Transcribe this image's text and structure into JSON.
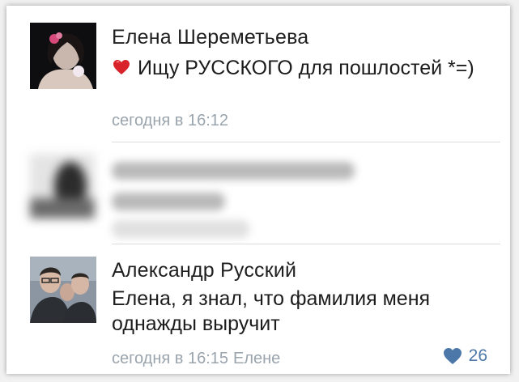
{
  "comments": [
    {
      "author": "Елена Шереметьева",
      "text": "Ищу РУССКОГО для пошлостей *=)",
      "time": "сегодня в 16:12",
      "emoji_icon": "red-heart-emoji-icon"
    },
    {
      "author": "",
      "text": "",
      "time": "",
      "blurred": true
    },
    {
      "author": "Александр Русский",
      "text": "Елена, я знал, что фамилия меня однажды выручит",
      "time": "сегодня в 16:15",
      "reply_to": "Елене",
      "likes": "26",
      "like_icon": "heart-icon"
    }
  ],
  "colors": {
    "meta_text": "#9aa4ad",
    "like_accent": "#4b78a8",
    "emoji_red": "#d8232a"
  }
}
